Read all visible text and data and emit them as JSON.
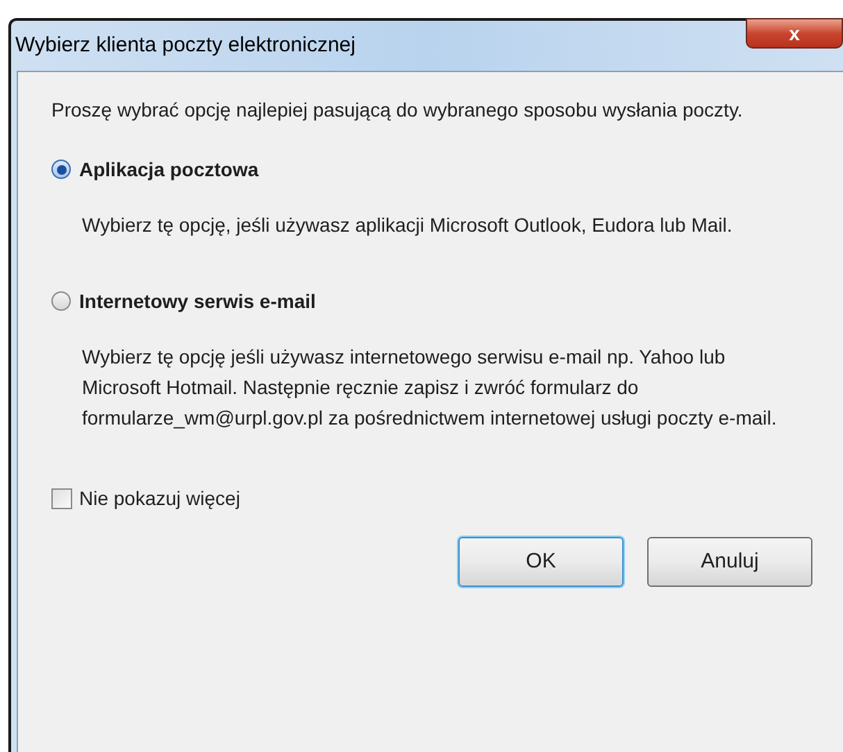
{
  "window": {
    "title": "Wybierz klienta poczty elektronicznej",
    "close": "x"
  },
  "intro": "Proszę wybrać opcję najlepiej pasującą do wybranego sposobu wysłania poczty.",
  "options": [
    {
      "label": "Aplikacja pocztowa",
      "selected": true,
      "description": "Wybierz tę opcję, jeśli używasz aplikacji Microsoft Outlook, Eudora lub Mail."
    },
    {
      "label": "Internetowy serwis e-mail",
      "selected": false,
      "description": "Wybierz tę opcję jeśli używasz internetowego serwisu e-mail np. Yahoo lub Microsoft Hotmail. Następnie ręcznie zapisz i zwróć formularz do formularze_wm@urpl.gov.pl za pośrednictwem internetowej usługi poczty e-mail."
    }
  ],
  "dont_show": {
    "label": "Nie pokazuj więcej",
    "checked": false
  },
  "buttons": [
    {
      "label": "OK",
      "kind": "default"
    },
    {
      "label": "Anuluj",
      "kind": "normal"
    }
  ]
}
